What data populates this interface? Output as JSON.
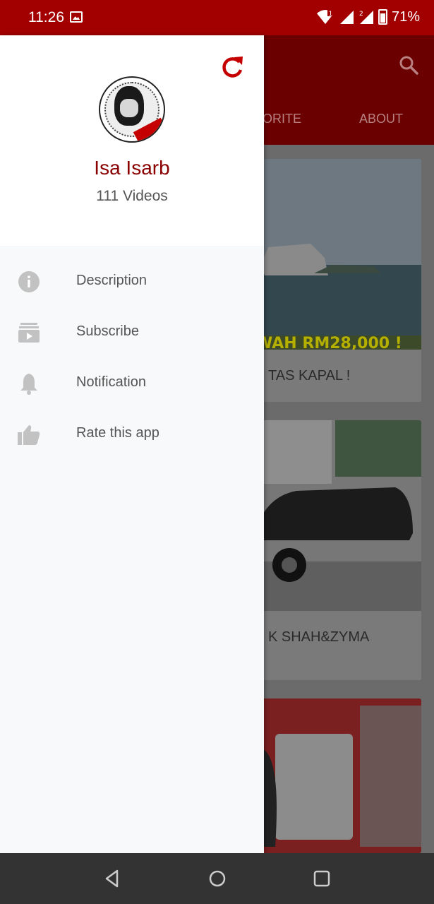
{
  "status_bar": {
    "time": "11:26",
    "battery_percent": "71%",
    "signal_labels": [
      "1",
      "2"
    ],
    "icons": [
      "gallery-icon",
      "wifi-icon",
      "cell-signal-icon",
      "battery-icon"
    ]
  },
  "background_app": {
    "header_color": "#6b0000",
    "tabs": [
      "ORITE",
      "ABOUT"
    ],
    "search_icon": "search-icon",
    "cards": [
      {
        "title": "TAS KAPAL !",
        "overlay_text": "WAH RM28,000 !"
      },
      {
        "title": "K SHAH&ZYMA",
        "overlay_text": ""
      },
      {
        "title": "",
        "overlay_text": ""
      }
    ]
  },
  "drawer": {
    "refresh_icon": "refresh-icon",
    "channel_name": "Isa Isarb",
    "video_count": "111 Videos",
    "avatar_ribbon_text": "ISA ISARB",
    "accent_color": "#c40000",
    "menu": [
      {
        "label": "Description",
        "icon": "info-icon"
      },
      {
        "label": "Subscribe",
        "icon": "subscriptions-icon"
      },
      {
        "label": "Notification",
        "icon": "bell-icon"
      },
      {
        "label": "Rate this app",
        "icon": "thumbs-up-icon"
      }
    ]
  },
  "nav_bar": {
    "buttons": [
      "back-icon",
      "home-icon",
      "recents-icon"
    ]
  }
}
